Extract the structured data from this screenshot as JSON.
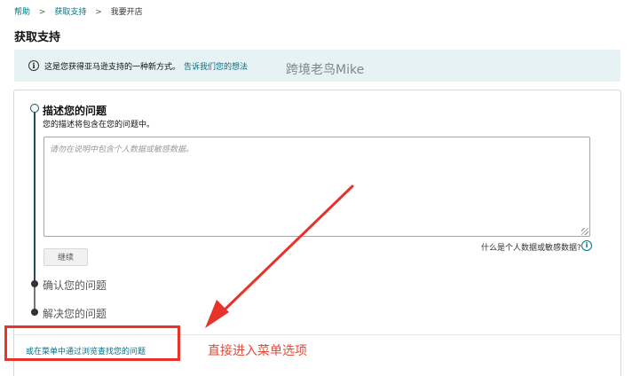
{
  "breadcrumb": {
    "items": [
      "帮助",
      "获取支持",
      "我要开店"
    ],
    "separator": ">"
  },
  "page_title": "获取支持",
  "banner": {
    "icon": "info-icon",
    "message": "这是您获得亚马逊支持的一种新方式。",
    "link": "告诉我们您的想法"
  },
  "watermark": "跨境老鸟Mike",
  "steps": [
    {
      "title": "描述您的问题",
      "description": "您的描述将包含在您的问题中。",
      "state": "active"
    },
    {
      "title": "确认您的问题",
      "state": "pending"
    },
    {
      "title": "解决您的问题",
      "state": "pending"
    }
  ],
  "description_input": {
    "placeholder": "请勿在说明中包含个人数据或敏感数据。",
    "value": ""
  },
  "privacy_help": {
    "text": "什么是个人数据或敏感数据?",
    "icon": "info-icon"
  },
  "continue_button": "继续",
  "browse_link": "或在菜单中通过浏览查找您的问题",
  "annotation": {
    "text": "直接进入菜单选项",
    "color": "#e8332a"
  },
  "colors": {
    "link": "#007185",
    "banner_bg": "#e6f2f3",
    "step_active": "#1f4f5a"
  }
}
